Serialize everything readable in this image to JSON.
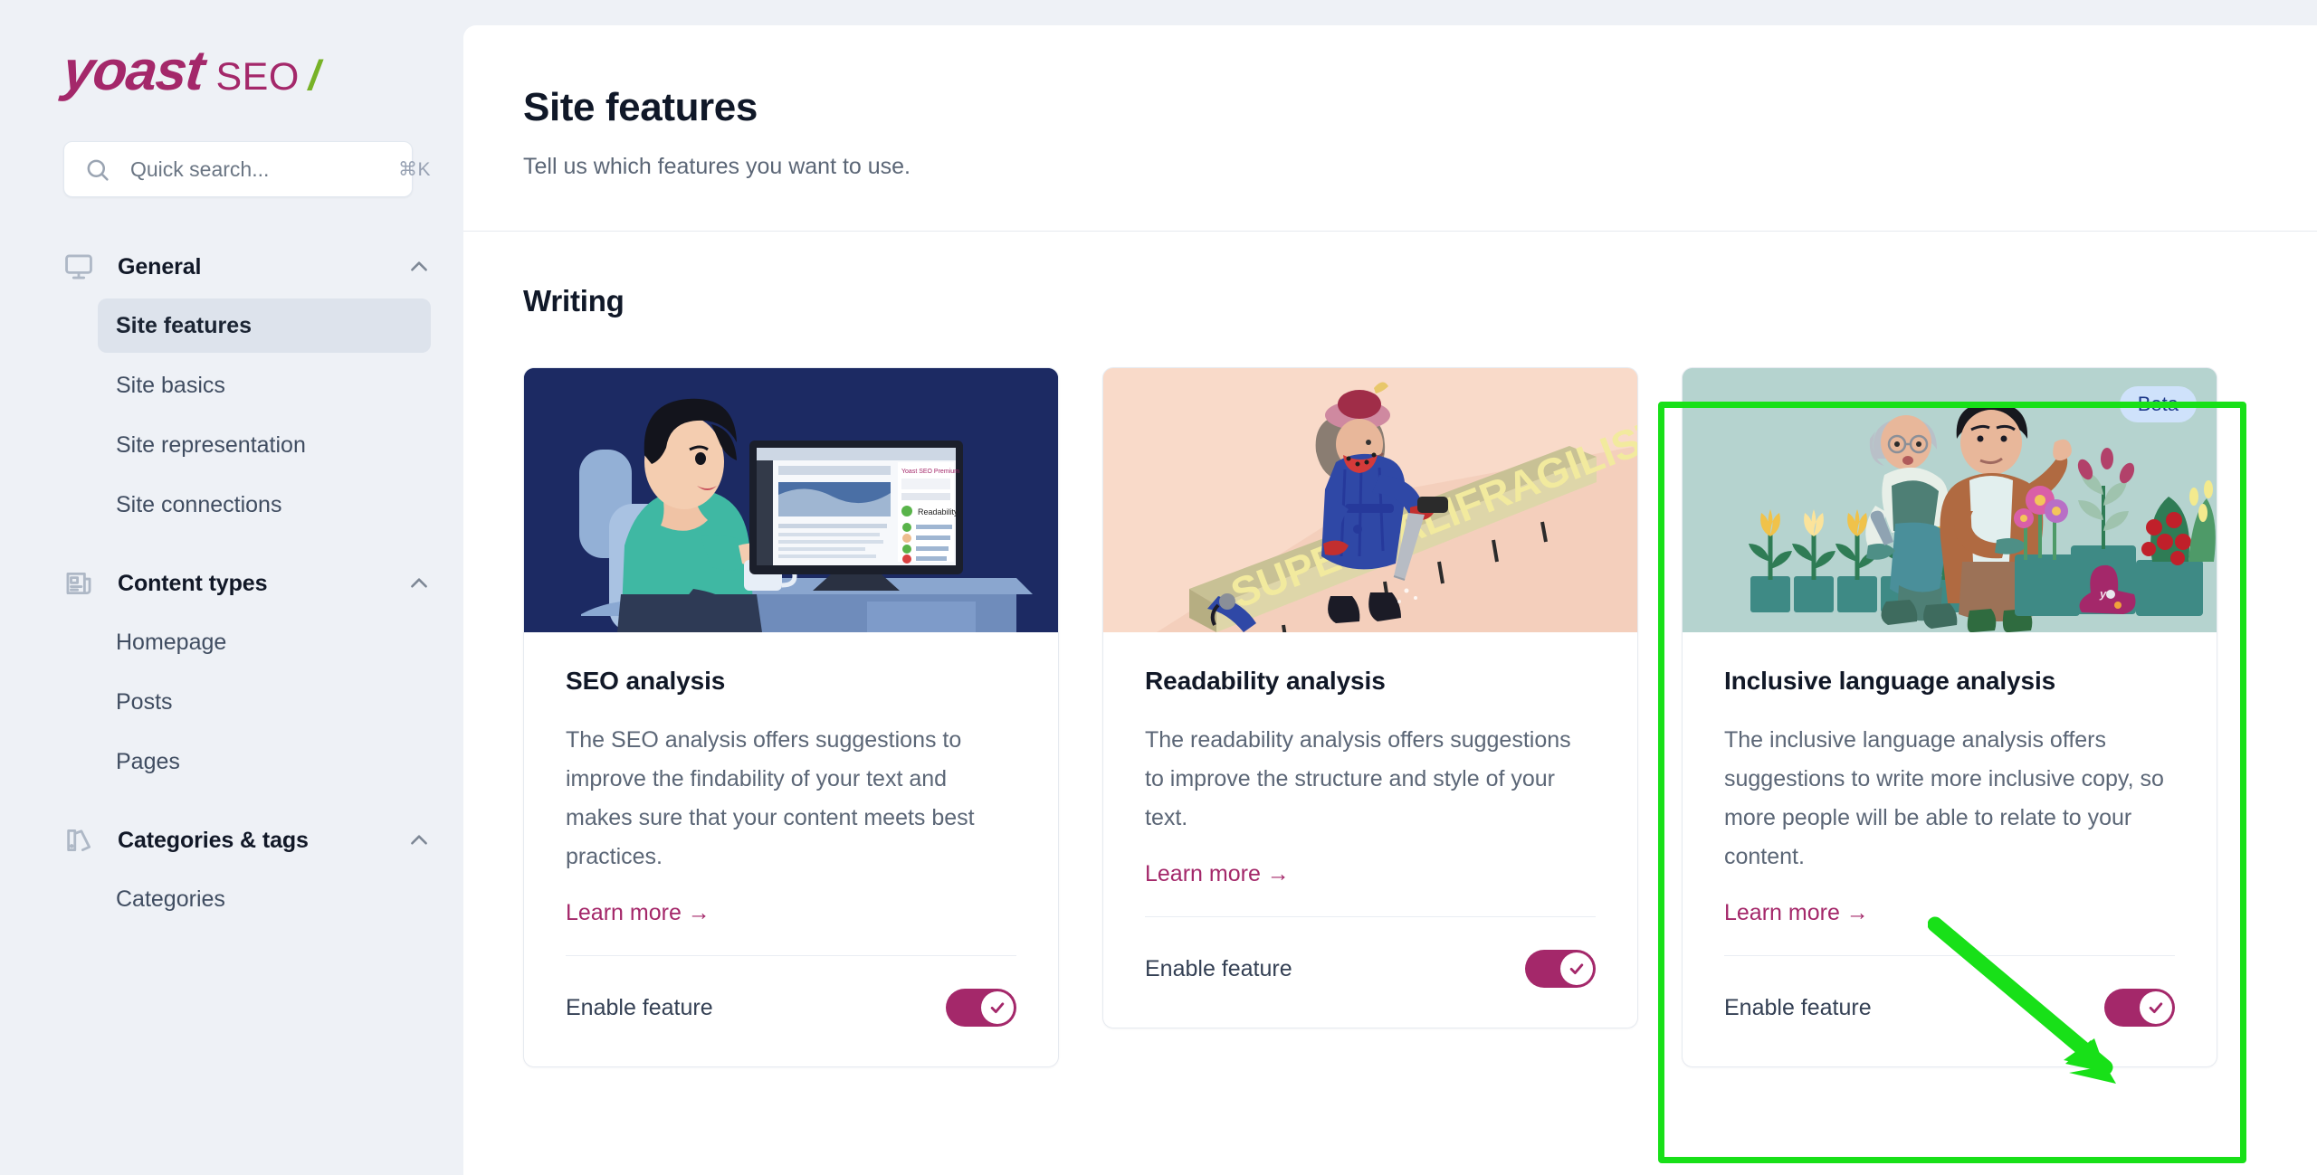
{
  "brand": {
    "logo_primary": "yoast",
    "logo_secondary": "SEO",
    "logo_mark": "/",
    "brand_color": "#a4286a",
    "accent_green": "#77b227"
  },
  "search": {
    "placeholder": "Quick search...",
    "value": "",
    "shortcut": "⌘K",
    "icon": "search-icon"
  },
  "sidebar": {
    "groups": [
      {
        "label": "General",
        "icon": "monitor-icon",
        "expanded": true,
        "chevron": "chevron-up-icon",
        "items": [
          {
            "label": "Site features",
            "active": true
          },
          {
            "label": "Site basics",
            "active": false
          },
          {
            "label": "Site representation",
            "active": false
          },
          {
            "label": "Site connections",
            "active": false
          }
        ]
      },
      {
        "label": "Content types",
        "icon": "article-icon",
        "expanded": true,
        "chevron": "chevron-up-icon",
        "items": [
          {
            "label": "Homepage",
            "active": false
          },
          {
            "label": "Posts",
            "active": false
          },
          {
            "label": "Pages",
            "active": false
          }
        ]
      },
      {
        "label": "Categories & tags",
        "icon": "tags-icon",
        "expanded": true,
        "chevron": "chevron-up-icon",
        "items": [
          {
            "label": "Categories",
            "active": false
          }
        ]
      }
    ]
  },
  "header": {
    "title": "Site features",
    "subtitle": "Tell us which features you want to use."
  },
  "section": {
    "title": "Writing"
  },
  "cards": [
    {
      "id": "seo-analysis",
      "title": "SEO analysis",
      "description": "The SEO analysis offers suggestions to improve the findability of your text and makes sure that your content meets best practices.",
      "link_label": "Learn more →",
      "enable_label": "Enable feature",
      "enabled": true,
      "badge": null,
      "media_bg": "#1c2a63",
      "media_alt": "woman-at-desk-illustration"
    },
    {
      "id": "readability-analysis",
      "title": "Readability analysis",
      "description": "The readability analysis offers suggestions to improve the structure and style of your text.",
      "link_label": "Learn more →",
      "enable_label": "Enable feature",
      "enabled": true,
      "badge": null,
      "media_bg": "#f9dac9",
      "media_alt": "sawing-long-word-illustration",
      "media_word": "SUPERCALIFRAGILISTICEXPIALIDOCIOUS"
    },
    {
      "id": "inclusive-language-analysis",
      "title": "Inclusive language analysis",
      "description": "The inclusive language analysis offers suggestions to write more inclusive copy, so more people will be able to relate to your content.",
      "link_label": "Learn more →",
      "enable_label": "Enable feature",
      "enabled": true,
      "badge": "Beta",
      "media_bg": "#b5d3cf",
      "media_alt": "gardening-people-illustration"
    }
  ],
  "annotations": {
    "highlight_color": "#18e018",
    "arrow_color": "#18e018",
    "highlighted_card": "inclusive-language-analysis",
    "arrow_points_to": "enable-feature-toggle"
  }
}
